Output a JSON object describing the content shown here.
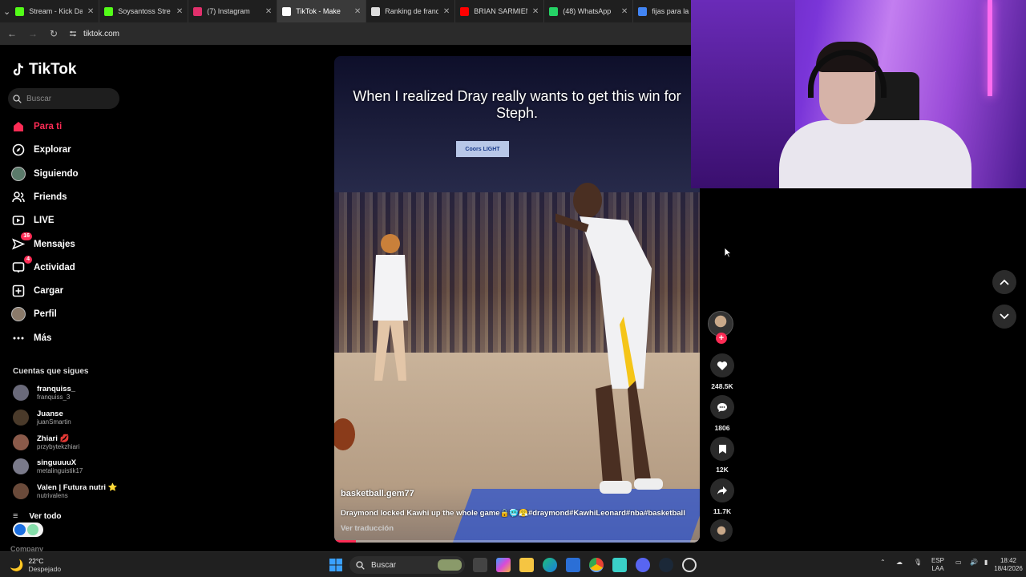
{
  "browser": {
    "tabs": [
      {
        "label": "Stream - Kick Das",
        "color": "#53fc18"
      },
      {
        "label": "Soysantoss Stre",
        "color": "#53fc18"
      },
      {
        "label": "(7) Instagram",
        "color": "#e1306c"
      },
      {
        "label": "TikTok - Make",
        "color": "#ffffff",
        "active": true
      },
      {
        "label": "Ranking de franq",
        "color": "#dddddd"
      },
      {
        "label": "BRIAN SARMIENT",
        "color": "#ff0000"
      },
      {
        "label": "(48) WhatsApp",
        "color": "#25d366"
      },
      {
        "label": "fijas para la",
        "color": "#4285f4"
      }
    ],
    "url": "tiktok.com"
  },
  "sidebar": {
    "logo": "TikTok",
    "search_placeholder": "Buscar",
    "nav": [
      {
        "label": "Para ti",
        "icon": "home-icon",
        "active": true
      },
      {
        "label": "Explorar",
        "icon": "compass-icon"
      },
      {
        "label": "Siguiendo",
        "icon": "following-avatar-icon"
      },
      {
        "label": "Friends",
        "icon": "friends-icon"
      },
      {
        "label": "LIVE",
        "icon": "live-icon"
      },
      {
        "label": "Mensajes",
        "icon": "message-icon",
        "badge": "16"
      },
      {
        "label": "Actividad",
        "icon": "activity-icon",
        "badge": "4"
      },
      {
        "label": "Cargar",
        "icon": "upload-icon"
      },
      {
        "label": "Perfil",
        "icon": "profile-avatar-icon"
      },
      {
        "label": "Más",
        "icon": "more-icon"
      }
    ],
    "following_title": "Cuentas que sigues",
    "following": [
      {
        "name": "franquiss_",
        "handle": "franquiss_3",
        "color": "#6a6a7a"
      },
      {
        "name": "Juanse",
        "handle": "juanSmartin",
        "color": "#4a3a2a"
      },
      {
        "name": "Zhiari 💋",
        "handle": "przybytekzhiari",
        "color": "#8a5a4a"
      },
      {
        "name": "singuuuuX",
        "handle": "metalinguistik17",
        "color": "#7a7a8a"
      },
      {
        "name": "Valen | Futura nutri ⭐",
        "handle": "nutrivalens",
        "color": "#6a4a3a"
      }
    ],
    "see_all": "Ver todo",
    "company": "Company"
  },
  "video": {
    "overlay_text": "When I realized Dray really wants to get this win for Steph.",
    "sign_text": "Coors LIGHT",
    "author": "basketball.gem77",
    "description": "Draymond locked Kawhi up the whole game🔒🥶😤#draymond#KawhiLeonard#nba#basketball",
    "translate": "Ver traducción",
    "progress": 0.06
  },
  "actions": {
    "likes": "248.5K",
    "comments": "1806",
    "saves": "12K",
    "shares": "11.7K"
  },
  "taskbar": {
    "temp": "22°C",
    "weather": "Despejado",
    "search": "Buscar",
    "lang1": "ESP",
    "lang2": "LAA",
    "time": "18:42",
    "date": "18/4/2026"
  }
}
